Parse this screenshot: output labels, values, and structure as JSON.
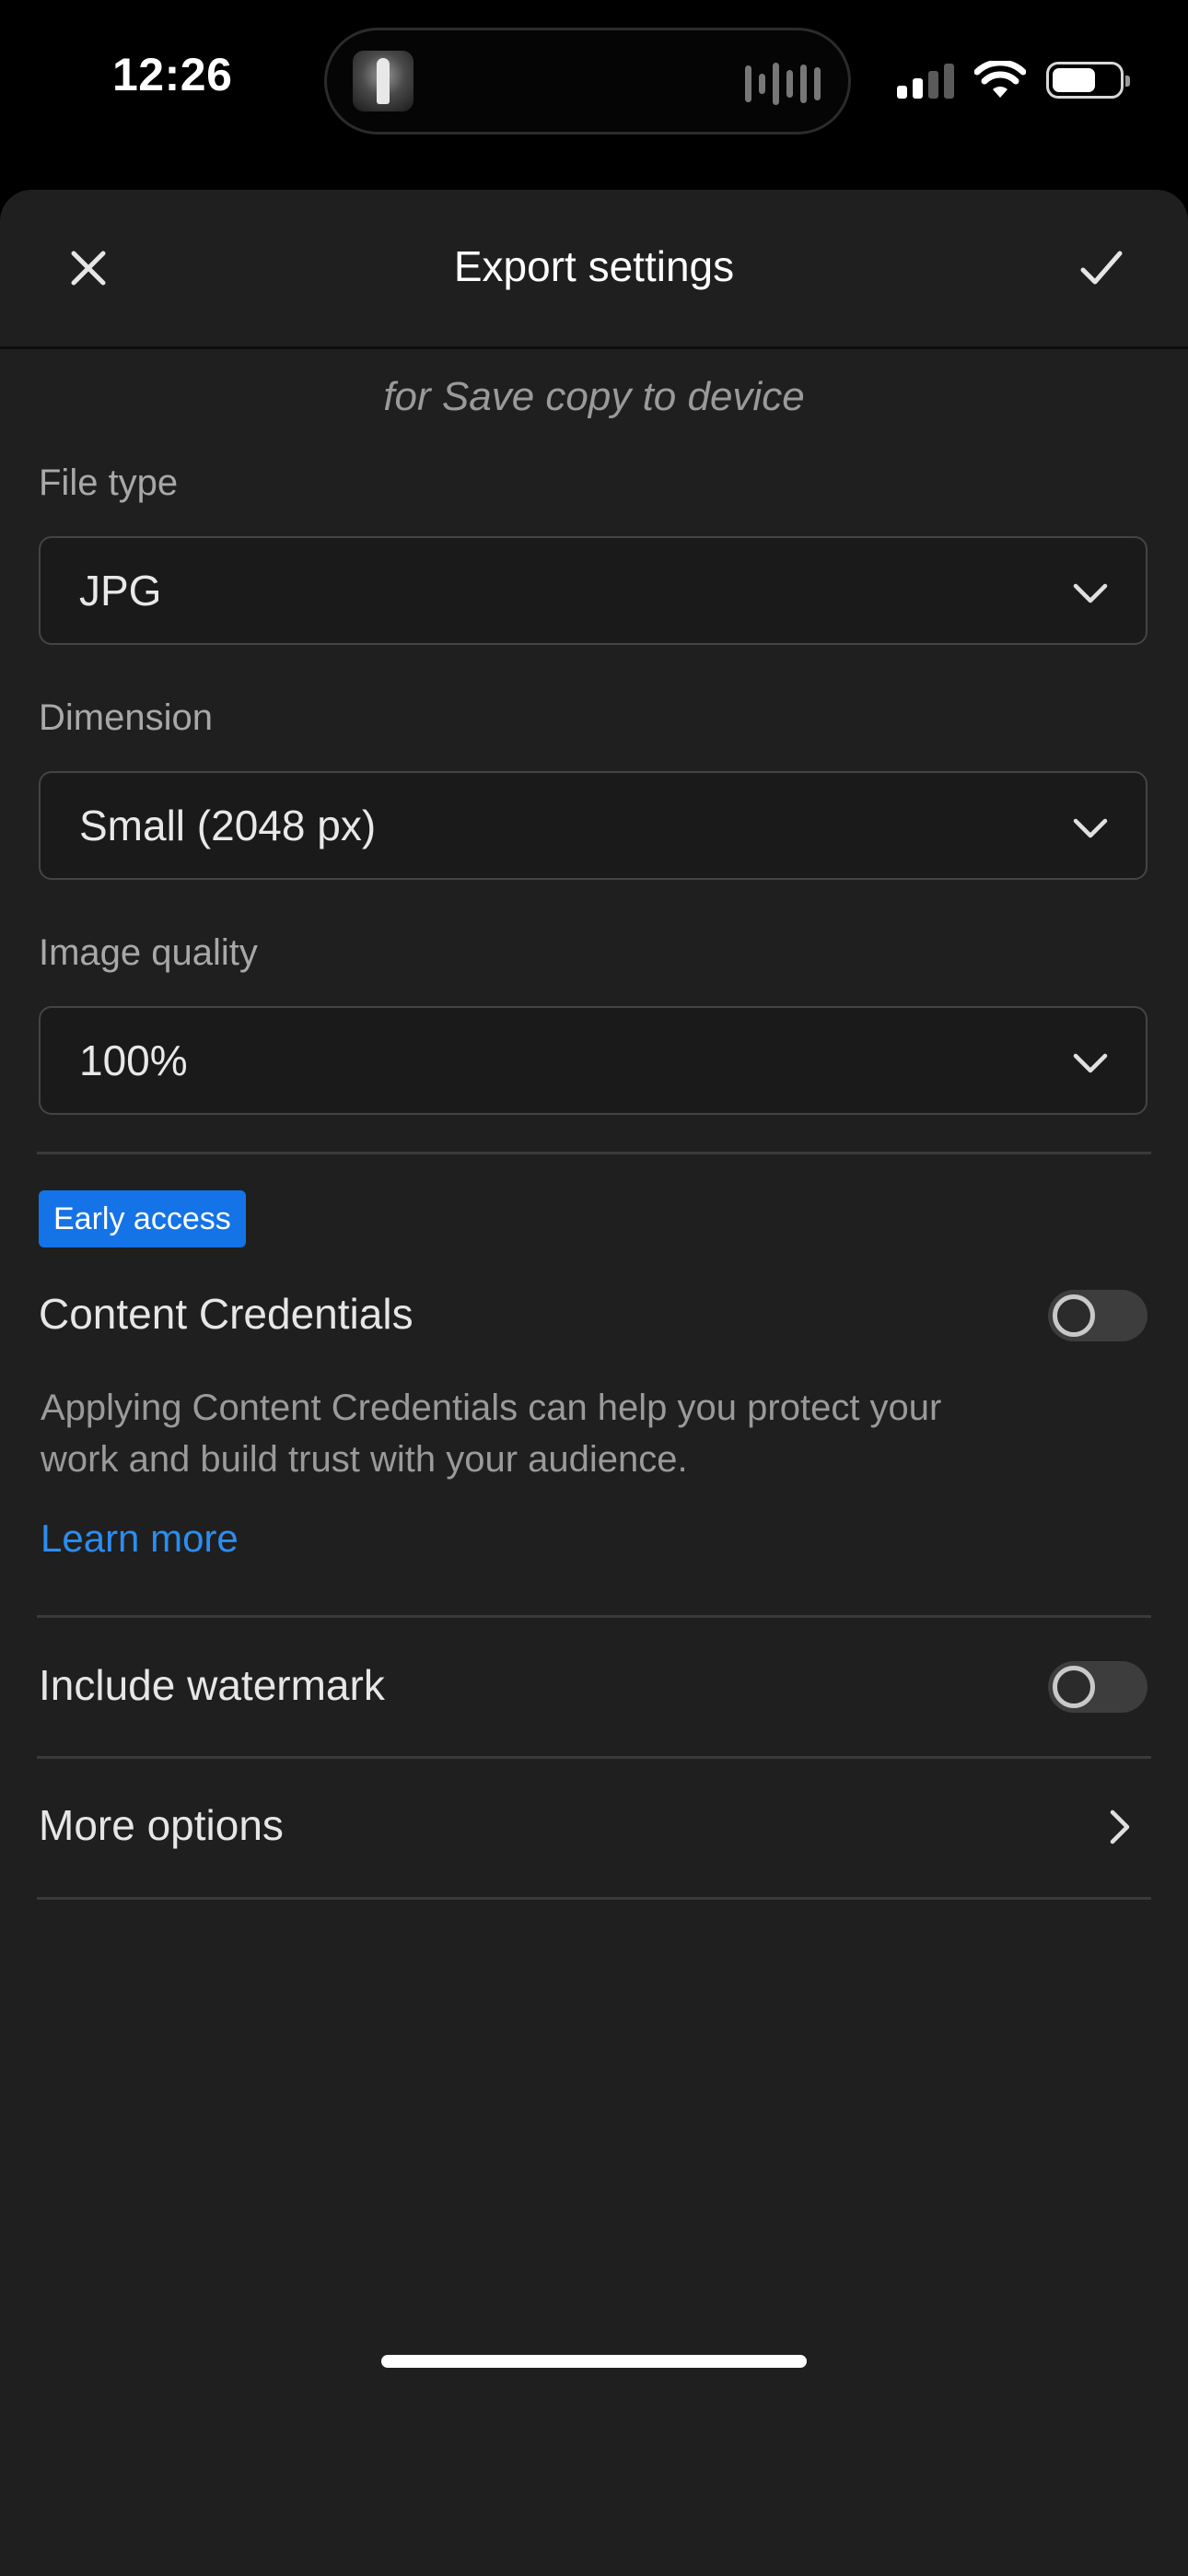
{
  "status_bar": {
    "time": "12:26",
    "icons": [
      "now-playing-thumbnail",
      "audio-waveform-icon",
      "cellular-signal-icon",
      "wifi-icon",
      "battery-icon"
    ]
  },
  "sheet": {
    "title": "Export settings",
    "close_icon": "close-icon",
    "confirm_icon": "checkmark-icon",
    "subtitle": "for Save copy to device"
  },
  "fields": {
    "file_type": {
      "label": "File type",
      "value": "JPG"
    },
    "dimension": {
      "label": "Dimension",
      "value": "Small (2048 px)"
    },
    "image_quality": {
      "label": "Image quality",
      "value": "100%"
    }
  },
  "content_credentials": {
    "badge": "Early access",
    "label": "Content Credentials",
    "enabled": false,
    "description": "Applying Content Credentials can help you protect your work and build trust with your audience.",
    "link": "Learn more"
  },
  "watermark": {
    "label": "Include watermark",
    "enabled": false
  },
  "more_options": {
    "label": "More options"
  },
  "colors": {
    "background": "#1f1f1f",
    "accent_badge": "#1473e6",
    "link": "#2c8df0",
    "toggle_off": "#3d3d3d"
  }
}
